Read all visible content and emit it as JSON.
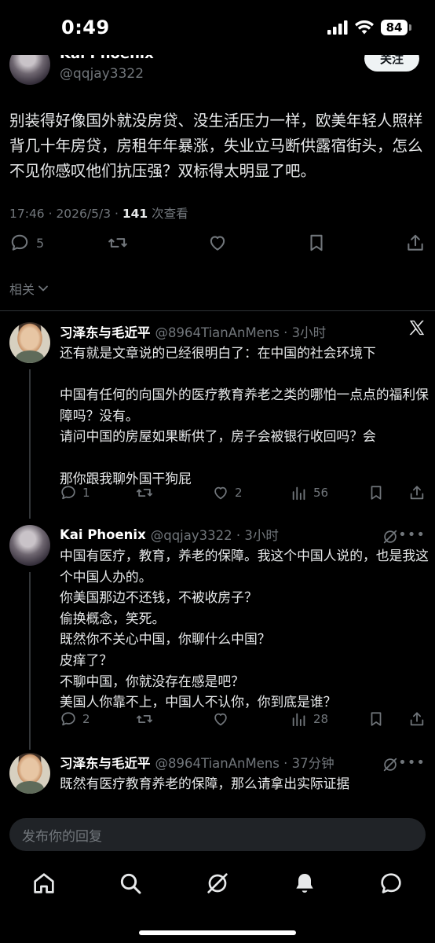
{
  "status_bar": {
    "time": "0:49",
    "battery": "84"
  },
  "author": {
    "name": "Kai Phoenix",
    "handle": "@qqjay3322",
    "follow_label": "关注"
  },
  "post": {
    "text": "别装得好像国外就没房贷、没生活压力一样，欧美年轻人照样背几十年房贷，房租年年暴涨，失业立马断供露宿街头，怎么不见你感叹他们抗压强？双标得太明显了吧。",
    "timestamp": "17:46 · 2026/5/3 · ",
    "views_count": "141",
    "views_label": " 次查看",
    "reply_count": "5"
  },
  "related_label": "相关",
  "replies": [
    {
      "name": "习泽东与毛近平",
      "handle": "@8964TianAnMens · 3小时",
      "text": "还有就是文章说的已经很明白了：在中国的社会环境下\n\n中国有任何的向国外的医疗教育养老之类的哪怕一点点的福利保障吗？没有。\n请问中国的房屋如果断供了，房子会被银行收回吗？会\n\n那你跟我聊外国干狗屁",
      "replies": "1",
      "likes": "2",
      "views": "56"
    },
    {
      "name": "Kai Phoenix",
      "handle": "@qqjay3322 · 3小时",
      "text": "中国有医疗，教育，养老的保障。我这个中国人说的，也是我这个中国人办的。\n你美国那边不还钱，不被收房子？\n偷换概念，笑死。\n既然你不关心中国，你聊什么中国？\n皮痒了？\n不聊中国，你就没存在感是吧？\n美国人你靠不上，中国人不认你，你到底是谁？",
      "replies": "2",
      "likes": "",
      "views": "28"
    },
    {
      "name": "习泽东与毛近平",
      "handle": "@8964TianAnMens · 37分钟",
      "text": "既然有医疗教育养老的保障，那么请拿出实际证据"
    }
  ],
  "reply_input": {
    "placeholder": "发布你的回复"
  },
  "icons": {
    "tabs": [
      "home-icon",
      "search-icon",
      "grok-icon",
      "notifications-icon",
      "messages-icon"
    ]
  }
}
